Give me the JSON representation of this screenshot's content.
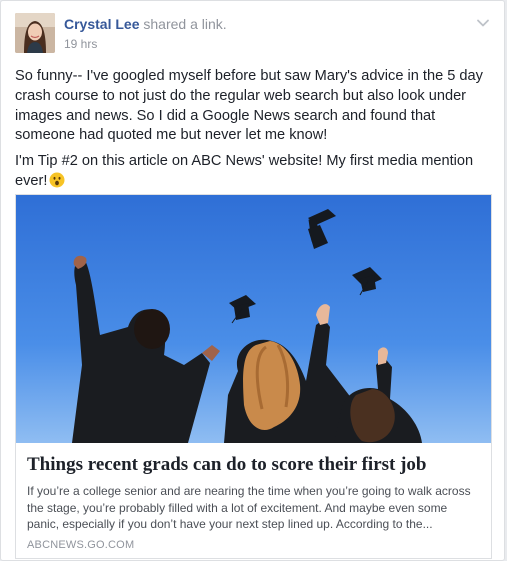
{
  "post": {
    "author": "Crystal Lee",
    "action": "shared a link.",
    "timestamp": "19 hrs",
    "paragraphs": [
      "So funny-- I've googled myself before but saw Mary's advice in the 5 day crash course to not just do the regular web search but also look under images and news. So I did a Google News search and found that someone had quoted me but never let me know!",
      "I'm Tip #2 on this article on ABC News' website! My first media mention ever!"
    ],
    "emoji": "surprised-face-emoji",
    "menu_icon": "chevron-down-icon"
  },
  "link": {
    "title": "Things recent grads can do to score their first job",
    "description": "If you’re a college senior and are nearing the time when you’re going to walk across the stage, you’re probably filled with a lot of excitement. And maybe even some panic, especially if you don’t have your next step lined up. According to the...",
    "domain": "ABCNEWS.GO.COM",
    "image": "graduates-throwing-caps-photo"
  },
  "colors": {
    "author_link": "#365899",
    "secondary_text": "#90949c",
    "body_text": "#1d2129",
    "sky": "#3d7fe0"
  }
}
